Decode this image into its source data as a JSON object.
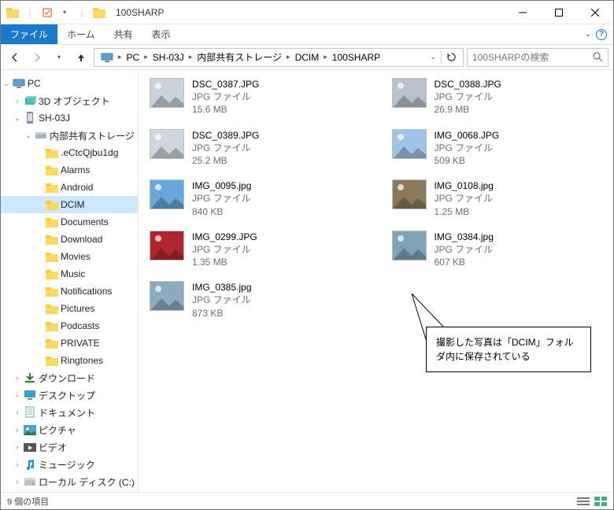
{
  "title": "100SHARP",
  "ribbon": {
    "file": "ファイル",
    "home": "ホーム",
    "share": "共有",
    "view": "表示"
  },
  "breadcrumb": [
    "PC",
    "SH-03J",
    "内部共有ストレージ",
    "DCIM",
    "100SHARP"
  ],
  "search_placeholder": "100SHARPの検索",
  "tree": [
    {
      "depth": 0,
      "expand": "open",
      "icon": "pc",
      "label": "PC"
    },
    {
      "depth": 1,
      "expand": "closed",
      "icon": "3d",
      "label": "3D オブジェクト"
    },
    {
      "depth": 1,
      "expand": "open",
      "icon": "phone",
      "label": "SH-03J"
    },
    {
      "depth": 2,
      "expand": "open",
      "icon": "drive",
      "label": "内部共有ストレージ"
    },
    {
      "depth": 3,
      "expand": "",
      "icon": "folder",
      "label": ".eCtcQjbu1dg"
    },
    {
      "depth": 3,
      "expand": "",
      "icon": "folder",
      "label": "Alarms"
    },
    {
      "depth": 3,
      "expand": "",
      "icon": "folder",
      "label": "Android"
    },
    {
      "depth": 3,
      "expand": "",
      "icon": "folder",
      "label": "DCIM",
      "selected": true
    },
    {
      "depth": 3,
      "expand": "",
      "icon": "folder",
      "label": "Documents"
    },
    {
      "depth": 3,
      "expand": "",
      "icon": "folder",
      "label": "Download"
    },
    {
      "depth": 3,
      "expand": "",
      "icon": "folder",
      "label": "Movies"
    },
    {
      "depth": 3,
      "expand": "",
      "icon": "folder",
      "label": "Music"
    },
    {
      "depth": 3,
      "expand": "",
      "icon": "folder",
      "label": "Notifications"
    },
    {
      "depth": 3,
      "expand": "",
      "icon": "folder",
      "label": "Pictures"
    },
    {
      "depth": 3,
      "expand": "",
      "icon": "folder",
      "label": "Podcasts"
    },
    {
      "depth": 3,
      "expand": "",
      "icon": "folder",
      "label": "PRIVATE"
    },
    {
      "depth": 3,
      "expand": "",
      "icon": "folder",
      "label": "Ringtones"
    },
    {
      "depth": 1,
      "expand": "closed",
      "icon": "downloads",
      "label": "ダウンロード"
    },
    {
      "depth": 1,
      "expand": "closed",
      "icon": "desktop",
      "label": "デスクトップ"
    },
    {
      "depth": 1,
      "expand": "closed",
      "icon": "documents",
      "label": "ドキュメント"
    },
    {
      "depth": 1,
      "expand": "closed",
      "icon": "pictures",
      "label": "ピクチャ"
    },
    {
      "depth": 1,
      "expand": "closed",
      "icon": "videos",
      "label": "ビデオ"
    },
    {
      "depth": 1,
      "expand": "closed",
      "icon": "music",
      "label": "ミュージック"
    },
    {
      "depth": 1,
      "expand": "closed",
      "icon": "disk",
      "label": "ローカル ディスク (C:)"
    }
  ],
  "files": [
    {
      "name": "DSC_0387.JPG",
      "type": "JPG ファイル",
      "size": "15.6 MB",
      "thumb": "#c9d3dc"
    },
    {
      "name": "DSC_0388.JPG",
      "type": "JPG ファイル",
      "size": "26.9 MB",
      "thumb": "#b9c2cc"
    },
    {
      "name": "DSC_0389.JPG",
      "type": "JPG ファイル",
      "size": "25.2 MB",
      "thumb": "#cfd6de"
    },
    {
      "name": "IMG_0068.JPG",
      "type": "JPG ファイル",
      "size": "509 KB",
      "thumb": "#9fc4e8"
    },
    {
      "name": "IMG_0095.jpg",
      "type": "JPG ファイル",
      "size": "840 KB",
      "thumb": "#6aa7d9"
    },
    {
      "name": "IMG_0108.jpg",
      "type": "JPG ファイル",
      "size": "1.25 MB",
      "thumb": "#8a7a5a"
    },
    {
      "name": "IMG_0299.JPG",
      "type": "JPG ファイル",
      "size": "1.35 MB",
      "thumb": "#b0262e"
    },
    {
      "name": "IMG_0384.jpg",
      "type": "JPG ファイル",
      "size": "607 KB",
      "thumb": "#7fa4b8"
    },
    {
      "name": "IMG_0385.jpg",
      "type": "JPG ファイル",
      "size": "873 KB",
      "thumb": "#8cabc0"
    }
  ],
  "callout_text": "撮影した写真は「DCIM」フォルダ内に保存されている",
  "status_text": "9 個の項目"
}
